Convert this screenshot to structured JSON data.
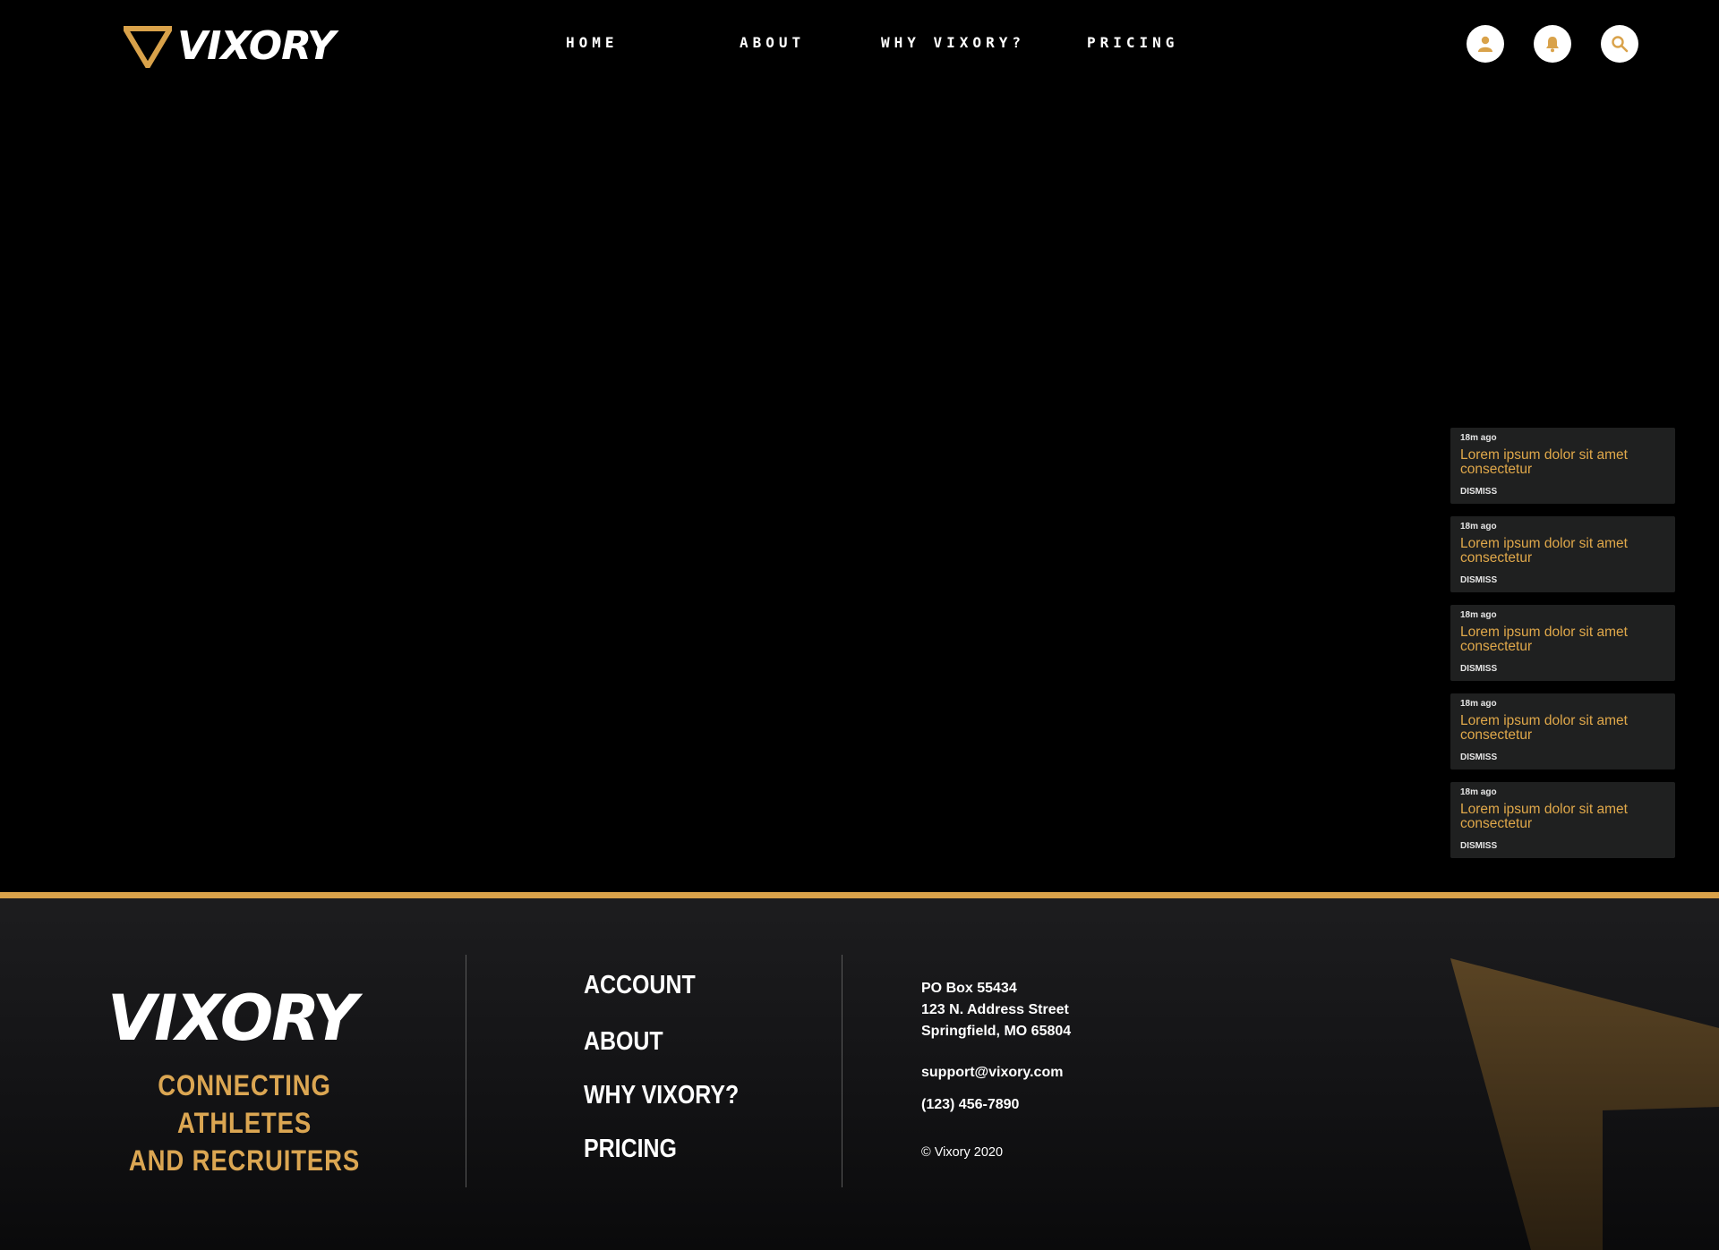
{
  "header": {
    "brand": "VIXORY",
    "nav": [
      {
        "label": "HOME"
      },
      {
        "label": "ABOUT"
      },
      {
        "label": "WHY VIXORY?"
      },
      {
        "label": "PRICING"
      }
    ],
    "icons": [
      "user-icon",
      "bell-icon",
      "search-icon"
    ]
  },
  "notifications": [
    {
      "time": "18m ago",
      "message": "Lorem ipsum dolor sit amet consectetur",
      "action": "DISMISS"
    },
    {
      "time": "18m ago",
      "message": "Lorem ipsum dolor sit amet consectetur",
      "action": "DISMISS"
    },
    {
      "time": "18m ago",
      "message": "Lorem ipsum dolor sit amet consectetur",
      "action": "DISMISS"
    },
    {
      "time": "18m ago",
      "message": "Lorem ipsum dolor sit amet consectetur",
      "action": "DISMISS"
    },
    {
      "time": "18m ago",
      "message": "Lorem ipsum dolor sit amet consectetur",
      "action": "DISMISS"
    }
  ],
  "footer": {
    "brand": "VIXORY",
    "tagline_line1": "CONNECTING ATHLETES",
    "tagline_line2": "AND RECRUITERS",
    "links": [
      {
        "label": "ACCOUNT"
      },
      {
        "label": "ABOUT"
      },
      {
        "label": "WHY VIXORY?"
      },
      {
        "label": "PRICING"
      }
    ],
    "address_line1": "PO Box 55434",
    "address_line2": "123 N. Address Street",
    "address_line3": "Springfield, MO 65804",
    "email": "support@vixory.com",
    "phone": "(123) 456-7890",
    "copyright": "© Vixory 2020"
  },
  "colors": {
    "background": "#000000",
    "accent": "#d9a24a",
    "notification_bg": "#1f2020",
    "notification_text": "#e0a84a"
  }
}
